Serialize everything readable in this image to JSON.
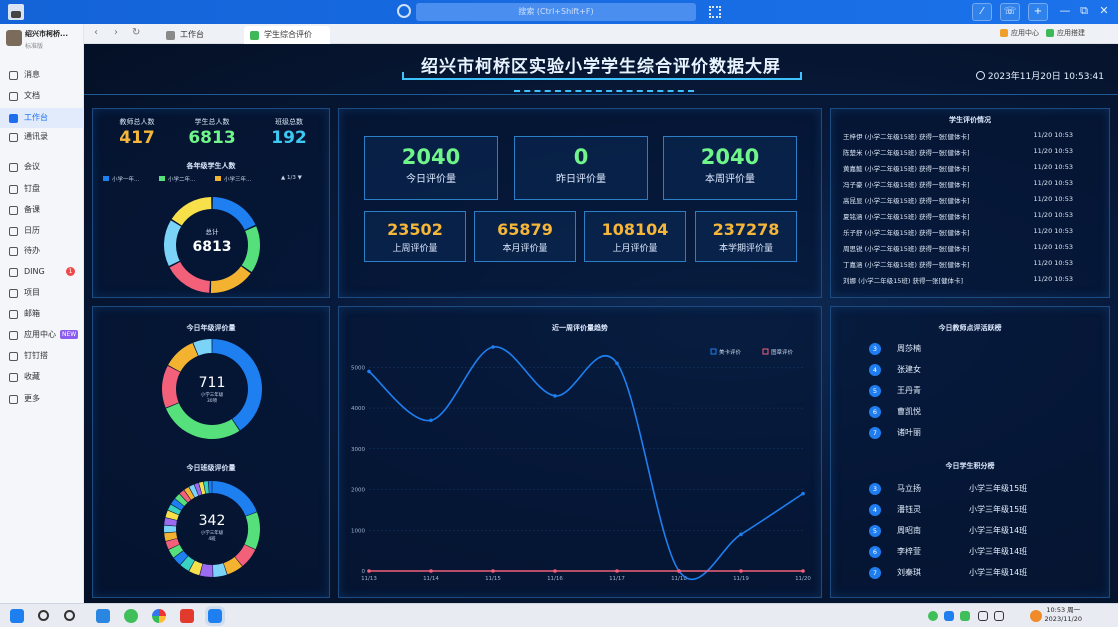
{
  "titlebar": {
    "search_placeholder": "搜索 (Ctrl+Shift+F)",
    "buttons": [
      "⁄",
      "☏",
      "+"
    ],
    "window_controls": [
      "—",
      "⧉",
      "✕"
    ]
  },
  "sidebar": {
    "org_name": "绍兴市柯桥...",
    "org_badge": "标准版",
    "items": [
      {
        "label": "消息"
      },
      {
        "label": "文档"
      },
      {
        "label": "工作台",
        "active": true
      },
      {
        "label": "通讯录"
      },
      {
        "label": "会议"
      },
      {
        "label": "钉盘"
      },
      {
        "label": "备课"
      },
      {
        "label": "日历"
      },
      {
        "label": "待办"
      },
      {
        "label": "DING",
        "badge": "1"
      },
      {
        "label": "项目"
      },
      {
        "label": "邮箱"
      },
      {
        "label": "应用中心",
        "tag": "NEW"
      },
      {
        "label": "钉钉搭"
      },
      {
        "label": "收藏"
      },
      {
        "label": "更多"
      }
    ]
  },
  "tabs": {
    "back": "‹",
    "forward": "›",
    "refresh": "↻",
    "items": [
      {
        "label": "工作台"
      },
      {
        "label": "学生综合评价"
      }
    ],
    "right_links": [
      {
        "label": "应用中心"
      },
      {
        "label": "应用搭建"
      }
    ]
  },
  "dashboard": {
    "title": "绍兴市柯桥区实验小学学生综合评价数据大屏",
    "clock": "2023年11月20日 10:53:41",
    "stats": [
      {
        "label": "教师总人数",
        "value": "417",
        "color": "#f5b63a"
      },
      {
        "label": "学生总人数",
        "value": "6813",
        "color": "#6ff58a"
      },
      {
        "label": "班级总数",
        "value": "192",
        "color": "#3ec9f3"
      }
    ],
    "grade_panel": {
      "title": "各年级学生人数",
      "legend": [
        "小学一年...",
        "小学二年...",
        "小学三年..."
      ],
      "legend_colors": [
        "#1e7ff0",
        "#55e07c",
        "#f3b22f"
      ],
      "pager": "1/3",
      "donut_label": "总计",
      "donut_value": "6813"
    },
    "kpis_top": [
      {
        "value": "2040",
        "label": "今日评价量",
        "color": "#6ff58a"
      },
      {
        "value": "0",
        "label": "昨日评价量",
        "color": "#6ff58a"
      },
      {
        "value": "2040",
        "label": "本周评价量",
        "color": "#6ff58a"
      }
    ],
    "kpis_bottom": [
      {
        "value": "23502",
        "label": "上周评价量",
        "color": "#f5b63a"
      },
      {
        "value": "65879",
        "label": "本月评价量",
        "color": "#f5b63a"
      },
      {
        "value": "108104",
        "label": "上月评价量",
        "color": "#f5b63a"
      },
      {
        "value": "237278",
        "label": "本学期评价量",
        "color": "#f5b63a"
      }
    ],
    "feed": {
      "title": "学生评价情况",
      "rows": [
        {
          "text": "王梓伊 (小学二年级15班) 获得一张[健体卡]",
          "time": "11/20 10:53"
        },
        {
          "text": "陈楚米 (小学二年级15班) 获得一张[健体卡]",
          "time": "11/20 10:53"
        },
        {
          "text": "黄嘉懿 (小学二年级15班) 获得一张[健体卡]",
          "time": "11/20 10:53"
        },
        {
          "text": "冯子豪 (小学二年级15班) 获得一张[健体卡]",
          "time": "11/20 10:53"
        },
        {
          "text": "高昆显 (小学二年级15班) 获得一张[健体卡]",
          "time": "11/20 10:53"
        },
        {
          "text": "夏铭涵 (小学二年级15班) 获得一张[健体卡]",
          "time": "11/20 10:53"
        },
        {
          "text": "乐子舒 (小学二年级15班) 获得一张[健体卡]",
          "time": "11/20 10:53"
        },
        {
          "text": "周思锐 (小学二年级15班) 获得一张[健体卡]",
          "time": "11/20 10:53"
        },
        {
          "text": "丁嘉涵 (小学二年级15班) 获得一张[健体卡]",
          "time": "11/20 10:53"
        },
        {
          "text": "刘娜 (小学二年级15班) 获得一张[健体卡]",
          "time": "11/20 10:53"
        }
      ]
    },
    "today_grade": {
      "title": "今日年级评价量",
      "value": "711",
      "sub1": "小学三年级",
      "sub2": "30项"
    },
    "today_class": {
      "title": "今日班级评价量",
      "value": "342",
      "sub1": "小学三年级",
      "sub2": "4班"
    },
    "teacher_rank": {
      "title": "今日教师点评活跃榜",
      "rows": [
        {
          "num": "3",
          "name": "周莎楠"
        },
        {
          "num": "4",
          "name": "张建女"
        },
        {
          "num": "5",
          "name": "王丹青"
        },
        {
          "num": "6",
          "name": "曹凯悦"
        },
        {
          "num": "7",
          "name": "诸叶丽"
        }
      ]
    },
    "student_rank": {
      "title": "今日学生积分榜",
      "rows": [
        {
          "num": "3",
          "name": "马立扬",
          "class": "小学三年级15班"
        },
        {
          "num": "4",
          "name": "潘钰灵",
          "class": "小学三年级15班"
        },
        {
          "num": "5",
          "name": "周昭南",
          "class": "小学三年级14班"
        },
        {
          "num": "6",
          "name": "李梓萱",
          "class": "小学三年级14班"
        },
        {
          "num": "7",
          "name": "刘秦琪",
          "class": "小学三年级14班"
        }
      ]
    }
  },
  "chart_data": [
    {
      "type": "pie",
      "title": "各年级学生人数",
      "series_colors": [
        "#1e7ff0",
        "#55e07c",
        "#f3b22f",
        "#f2607a",
        "#7bd3f7",
        "#f7e04a"
      ],
      "values": [
        1250,
        1120,
        1080,
        1150,
        1113,
        1100
      ]
    },
    {
      "type": "line",
      "title": "近一周评价量趋势",
      "categories": [
        "11/13",
        "11/14",
        "11/15",
        "11/16",
        "11/17",
        "11/18",
        "11/19",
        "11/20"
      ],
      "ylim": [
        0,
        5500
      ],
      "yticks": [
        "0",
        "1000",
        "2000",
        "3000",
        "4000",
        "5000"
      ],
      "legend": "top-right",
      "series": [
        {
          "name": "美卡评价",
          "color": "#1e7ff0",
          "values": [
            4900,
            3700,
            5500,
            4300,
            5100,
            0,
            900,
            1900
          ]
        },
        {
          "name": "图章评价",
          "color": "#f2607a",
          "values": [
            0,
            0,
            0,
            0,
            0,
            0,
            0,
            0
          ]
        }
      ]
    },
    {
      "type": "pie",
      "title": "今日年级评价量",
      "series_colors": [
        "#1e7ff0",
        "#55e07c",
        "#f2607a",
        "#f3b22f",
        "#7bd3f7"
      ],
      "values": [
        260,
        180,
        90,
        70,
        40
      ]
    },
    {
      "type": "pie",
      "title": "今日班级评价量",
      "series_colors": [
        "#1e7ff0",
        "#55e07c",
        "#f2607a",
        "#f3b22f",
        "#7bd3f7",
        "#9b6cf2",
        "#f7e04a",
        "#3ad3c2"
      ],
      "values": [
        60,
        40,
        22,
        18,
        15,
        14,
        12,
        11,
        10,
        10,
        9,
        9,
        8,
        8,
        8,
        7,
        7,
        7,
        6,
        6,
        6,
        5,
        5,
        5,
        4
      ]
    }
  ],
  "taskbar": {
    "time": "10:53 周一",
    "date": "2023/11/20"
  }
}
